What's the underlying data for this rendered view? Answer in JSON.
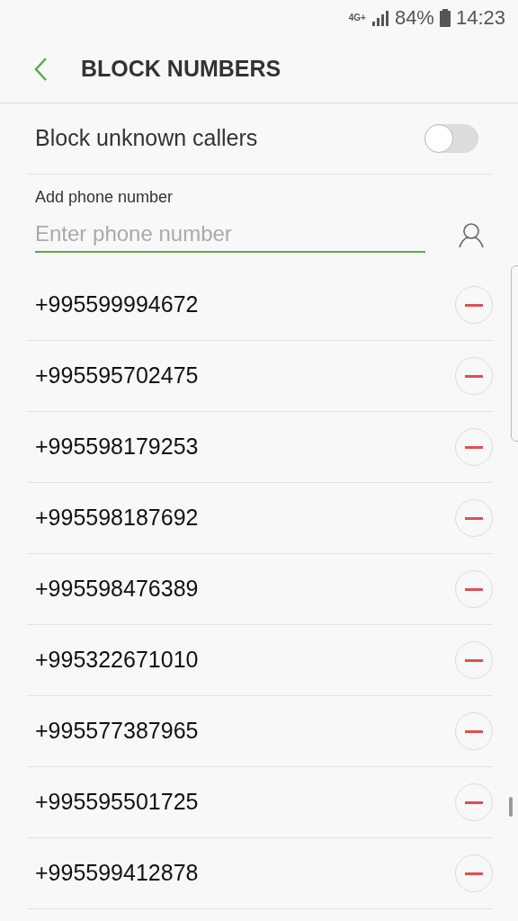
{
  "status_bar": {
    "network": "4G+",
    "battery": "84%",
    "time": "14:23"
  },
  "header": {
    "title": "BLOCK NUMBERS"
  },
  "block_unknown": {
    "label": "Block unknown callers",
    "on": false
  },
  "add_number": {
    "label": "Add phone number",
    "placeholder": "Enter phone number"
  },
  "numbers": [
    "+995599994672",
    "+995595702475",
    "+995598179253",
    "+995598187692",
    "+995598476389",
    "+995322671010",
    "+995577387965",
    "+995595501725",
    "+995599412878"
  ]
}
